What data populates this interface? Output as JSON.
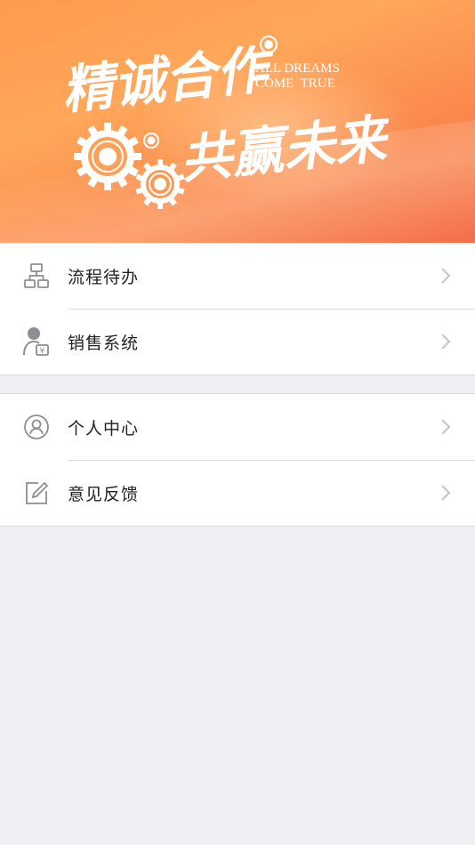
{
  "banner": {
    "slogan_cn_1": "精诚合作",
    "slogan_cn_2": "共赢未来",
    "slogan_en_1": "ALL DREAMS",
    "slogan_en_2": "COME  TRUE"
  },
  "menu": {
    "groups": [
      {
        "items": [
          {
            "label": "流程待办",
            "icon": "workflow-icon"
          },
          {
            "label": "销售系统",
            "icon": "sales-person-icon"
          }
        ]
      },
      {
        "items": [
          {
            "label": "个人中心",
            "icon": "user-circle-icon"
          },
          {
            "label": "意见反馈",
            "icon": "edit-feedback-icon"
          }
        ]
      }
    ]
  },
  "colors": {
    "banner_start": "#ff9a4e",
    "banner_end": "#f4704d",
    "background": "#efeff4",
    "icon_gray": "#8e8e93",
    "chevron_gray": "#c7c7cc"
  }
}
